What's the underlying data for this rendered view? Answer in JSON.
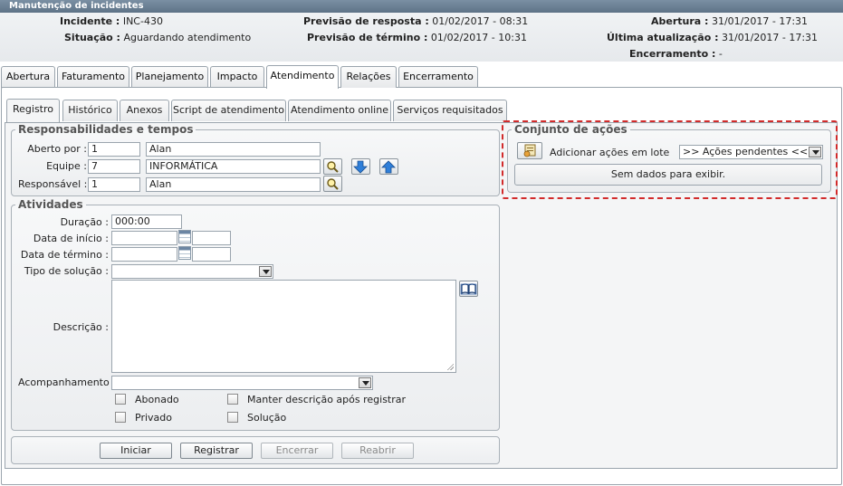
{
  "window": {
    "title": "Manutenção de incidentes"
  },
  "header": {
    "incidente_label": "Incidente :",
    "incidente_value": "INC-430",
    "situacao_label": "Situação :",
    "situacao_value": "Aguardando atendimento",
    "prev_resposta_label": "Previsão de resposta :",
    "prev_resposta_value": "01/02/2017 - 08:31",
    "prev_termino_label": "Previsão de término :",
    "prev_termino_value": "01/02/2017 - 10:31",
    "abertura_label": "Abertura :",
    "abertura_value": "31/01/2017 - 17:31",
    "ultima_label": "Última atualização :",
    "ultima_value": "31/01/2017 - 17:31",
    "encerramento_label": "Encerramento :",
    "encerramento_value": "-"
  },
  "main_tabs": [
    "Abertura",
    "Faturamento",
    "Planejamento",
    "Impacto",
    "Atendimento",
    "Relações",
    "Encerramento"
  ],
  "sub_tabs": [
    "Registro",
    "Histórico",
    "Anexos",
    "Script de atendimento",
    "Atendimento online",
    "Serviços requisitados"
  ],
  "responsabilidades": {
    "legend": "Responsabilidades e tempos",
    "aberto_label": "Aberto por :",
    "aberto_code": "1",
    "aberto_name": "Alan",
    "equipe_label": "Equipe :",
    "equipe_code": "7",
    "equipe_name": "INFORMÁTICA",
    "responsavel_label": "Responsável :",
    "responsavel_code": "1",
    "responsavel_name": "Alan"
  },
  "atividades": {
    "legend": "Atividades",
    "duracao_label": "Duração :",
    "duracao_value": "000:00",
    "inicio_label": "Data de início :",
    "inicio_date": "",
    "inicio_time": "",
    "termino_label": "Data de término :",
    "termino_date": "",
    "termino_time": "",
    "tipo_label": "Tipo de solução :",
    "tipo_value": "",
    "descricao_label": "Descrição :",
    "descricao_value": "",
    "acompanhamento_label": "Acompanhamento :",
    "acompanhamento_value": "",
    "abonado_label": "Abonado",
    "manter_label": "Manter descrição após registrar",
    "privado_label": "Privado",
    "solucao_label": "Solução"
  },
  "buttons": {
    "iniciar": "Iniciar",
    "registrar": "Registrar",
    "encerrar": "Encerrar",
    "reabrir": "Reabrir"
  },
  "acoes": {
    "legend": "Conjunto de ações",
    "adicionar_label": "Adicionar ações em lote",
    "pendentes_value": ">> Ações pendentes <<",
    "nodata": "Sem dados para exibir."
  },
  "colors": {
    "highlight": "#d22b2b",
    "titlebar": "#6b8094",
    "arrow_blue": "#2f7fd9"
  }
}
